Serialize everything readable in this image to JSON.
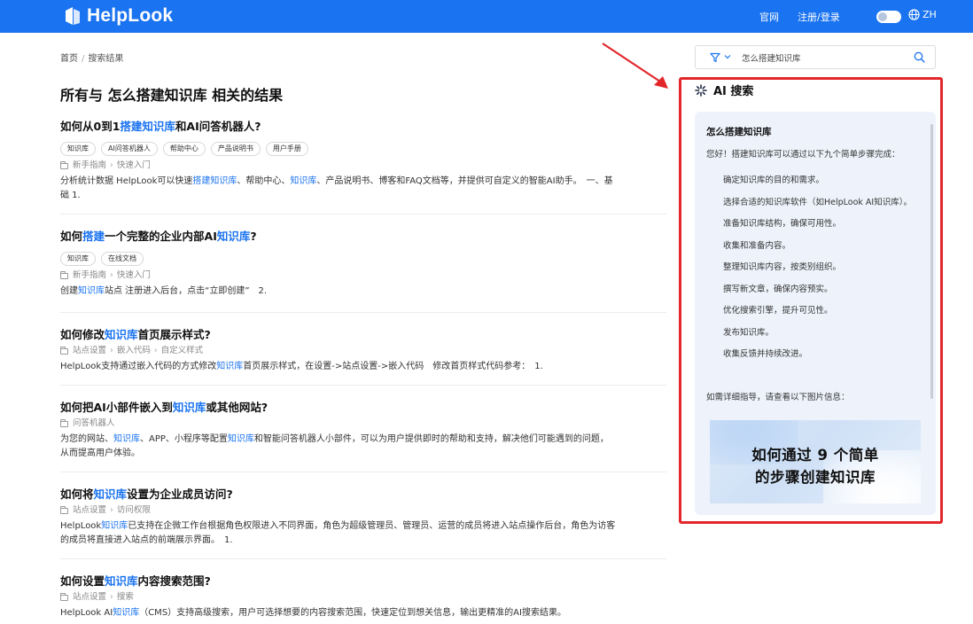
{
  "header": {
    "logo_text": "HelpLook",
    "nav": [
      "官网",
      "注册/登录"
    ],
    "lang": "ZH"
  },
  "breadcrumb": {
    "home": "首页",
    "separator": "/",
    "current": "搜索结果"
  },
  "results_heading": "所有与 怎么搭建知识库 相关的结果",
  "results": [
    {
      "title": [
        {
          "t": "如何从0到1"
        },
        {
          "t": "搭建知识库",
          "hl": true
        },
        {
          "t": "和AI问答机器人?"
        }
      ],
      "tags": [
        "知识库",
        "AI问答机器人",
        "帮助中心",
        "产品说明书",
        "用户手册"
      ],
      "path": [
        "新手指南",
        "快速入门"
      ],
      "desc_lines": [
        [
          {
            "t": "分析统计数据 HelpLook可以快速"
          },
          {
            "t": "搭建知识库",
            "hl": true
          },
          {
            "t": "、帮助中心、"
          },
          {
            "t": "知识库",
            "hl": true
          },
          {
            "t": "、产品说明书、博客和FAQ文档等，并提供可自定义的智能AI助手。　一、基"
          }
        ],
        [
          {
            "t": "础 1."
          }
        ]
      ]
    },
    {
      "title": [
        {
          "t": "如何"
        },
        {
          "t": "搭建",
          "hl": true
        },
        {
          "t": "一个完整的企业内部AI"
        },
        {
          "t": "知识库",
          "hl": true
        },
        {
          "t": "?"
        }
      ],
      "tags": [
        "知识库",
        "在线文档"
      ],
      "path": [
        "新手指南",
        "快速入门"
      ],
      "desc_lines": [
        [
          {
            "t": "创建"
          },
          {
            "t": "知识库",
            "hl": true
          },
          {
            "t": "站点 注册进入后台，点击“立即创建”　2."
          }
        ]
      ]
    },
    {
      "title": [
        {
          "t": "如何修改"
        },
        {
          "t": "知识库",
          "hl": true
        },
        {
          "t": "首页展示样式?"
        }
      ],
      "tags": [],
      "path": [
        "站点设置",
        "嵌入代码",
        "自定义样式"
      ],
      "desc_lines": [
        [
          {
            "t": "HelpLook支持通过嵌入代码的方式修改"
          },
          {
            "t": "知识库",
            "hl": true
          },
          {
            "t": "首页展示样式，在设置->站点设置->嵌入代码　修改首页样式代码参考：　1."
          }
        ]
      ]
    },
    {
      "title": [
        {
          "t": "如何把AI小部件嵌入到"
        },
        {
          "t": "知识库",
          "hl": true
        },
        {
          "t": "或其他网站?"
        }
      ],
      "tags": [],
      "path": [
        "问答机器人"
      ],
      "desc_lines": [
        [
          {
            "t": "为您的网站、"
          },
          {
            "t": "知识库",
            "hl": true
          },
          {
            "t": "、APP、小程序等配置"
          },
          {
            "t": "知识库",
            "hl": true
          },
          {
            "t": "和智能问答机器人小部件，可以为用户提供即时的帮助和支持，解决他们可能遇到的问题，"
          }
        ],
        [
          {
            "t": "从而提高用户体验。"
          }
        ]
      ]
    },
    {
      "title": [
        {
          "t": "如何将"
        },
        {
          "t": "知识库",
          "hl": true
        },
        {
          "t": "设置为企业成员访问?"
        }
      ],
      "tags": [],
      "path": [
        "站点设置",
        "访问权限"
      ],
      "desc_lines": [
        [
          {
            "t": "HelpLook"
          },
          {
            "t": "知识库",
            "hl": true
          },
          {
            "t": "已支持在企微工作台根据角色权限进入不同界面，角色为超级管理员、管理员、运营的成员将进入站点操作后台，角色为访客"
          }
        ],
        [
          {
            "t": "的成员将直接进入站点的前端展示界面。　1."
          }
        ]
      ]
    },
    {
      "title": [
        {
          "t": "如何设置"
        },
        {
          "t": "知识库",
          "hl": true
        },
        {
          "t": "内容搜索范围?"
        }
      ],
      "tags": [],
      "path": [
        "站点设置",
        "搜索"
      ],
      "desc_lines": [
        [
          {
            "t": "HelpLook AI"
          },
          {
            "t": "知识库",
            "hl": true
          },
          {
            "t": "（CMS）支持高级搜索，用户可选择想要的内容搜索范围，快速定位到想关信息，输出更精准的AI搜索结果。"
          }
        ]
      ]
    }
  ],
  "search": {
    "value": "怎么搭建知识库"
  },
  "ai_panel": {
    "title": "AI 搜索",
    "question": "怎么搭建知识库",
    "intro": "您好！搭建知识库可以通过以下九个简单步骤完成：",
    "steps": [
      "确定知识库的目的和需求。",
      "选择合适的知识库软件（如HelpLook AI知识库）。",
      "准备知识库结构，确保可用性。",
      "收集和准备内容。",
      "整理知识库内容，按类别组织。",
      "撰写新文章，确保内容预实。",
      "优化搜索引擎，提升可见性。",
      "发布知识库。",
      "收集反馈并持续改进。"
    ],
    "note": "如需详细指导，请查看以下图片信息：",
    "image_lines": [
      "如何通过 9 个简单",
      "的步骤创建知识库"
    ]
  },
  "colors": {
    "brand": "#1a73f0",
    "highlight": "#1a73f0",
    "annotation": "#e3262a"
  }
}
